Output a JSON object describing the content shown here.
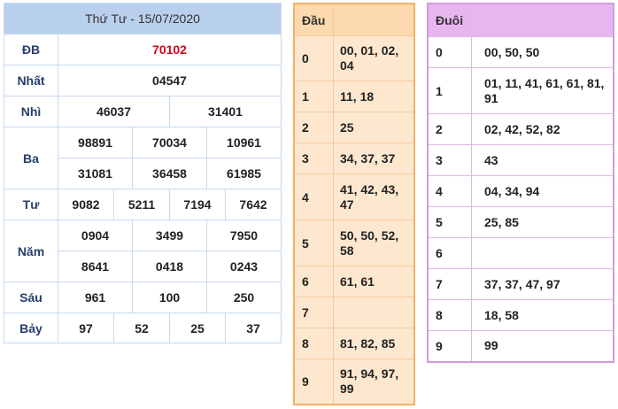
{
  "results": {
    "title": "Thứ Tư - 15/07/2020",
    "rows": {
      "db": {
        "label": "ĐB",
        "values": [
          "70102"
        ]
      },
      "nhat": {
        "label": "Nhất",
        "values": [
          "04547"
        ]
      },
      "nhi": {
        "label": "Nhì",
        "values": [
          "46037",
          "31401"
        ]
      },
      "ba": {
        "label": "Ba",
        "values": [
          "98891",
          "70034",
          "10961",
          "31081",
          "36458",
          "61985"
        ]
      },
      "tu": {
        "label": "Tư",
        "values": [
          "9082",
          "5211",
          "7194",
          "7642"
        ]
      },
      "nam": {
        "label": "Năm",
        "values": [
          "0904",
          "3499",
          "7950",
          "8641",
          "0418",
          "0243"
        ]
      },
      "sau": {
        "label": "Sáu",
        "values": [
          "961",
          "100",
          "250"
        ]
      },
      "bay": {
        "label": "Bảy",
        "values": [
          "97",
          "52",
          "25",
          "37"
        ]
      }
    }
  },
  "dau": {
    "header": "Đầu",
    "rows": [
      {
        "key": "0",
        "value": "00, 01, 02, 04"
      },
      {
        "key": "1",
        "value": "11, 18"
      },
      {
        "key": "2",
        "value": "25"
      },
      {
        "key": "3",
        "value": "34, 37, 37"
      },
      {
        "key": "4",
        "value": "41, 42, 43, 47"
      },
      {
        "key": "5",
        "value": "50, 50, 52, 58"
      },
      {
        "key": "6",
        "value": "61, 61"
      },
      {
        "key": "7",
        "value": ""
      },
      {
        "key": "8",
        "value": "81, 82, 85"
      },
      {
        "key": "9",
        "value": "91, 94, 97, 99"
      }
    ]
  },
  "duoi": {
    "header": "Đuôi",
    "rows": [
      {
        "key": "0",
        "value": "00, 50, 50"
      },
      {
        "key": "1",
        "value": "01, 11, 41, 61, 61, 81, 91"
      },
      {
        "key": "2",
        "value": "02, 42, 52, 82"
      },
      {
        "key": "3",
        "value": "43"
      },
      {
        "key": "4",
        "value": "04, 34, 94"
      },
      {
        "key": "5",
        "value": "25, 85"
      },
      {
        "key": "6",
        "value": ""
      },
      {
        "key": "7",
        "value": "37, 37, 47, 97"
      },
      {
        "key": "8",
        "value": "18, 58"
      },
      {
        "key": "9",
        "value": "99"
      }
    ]
  },
  "colors": {
    "results_header_bg": "#b9d0ec",
    "results_border": "#a9c4e4",
    "jackpot_text": "#d0021b",
    "dau_bg": "#fde7cf",
    "dau_border": "#f3b266",
    "duoi_header_bg": "#e9b5f1",
    "duoi_border": "#cf9bdd"
  }
}
